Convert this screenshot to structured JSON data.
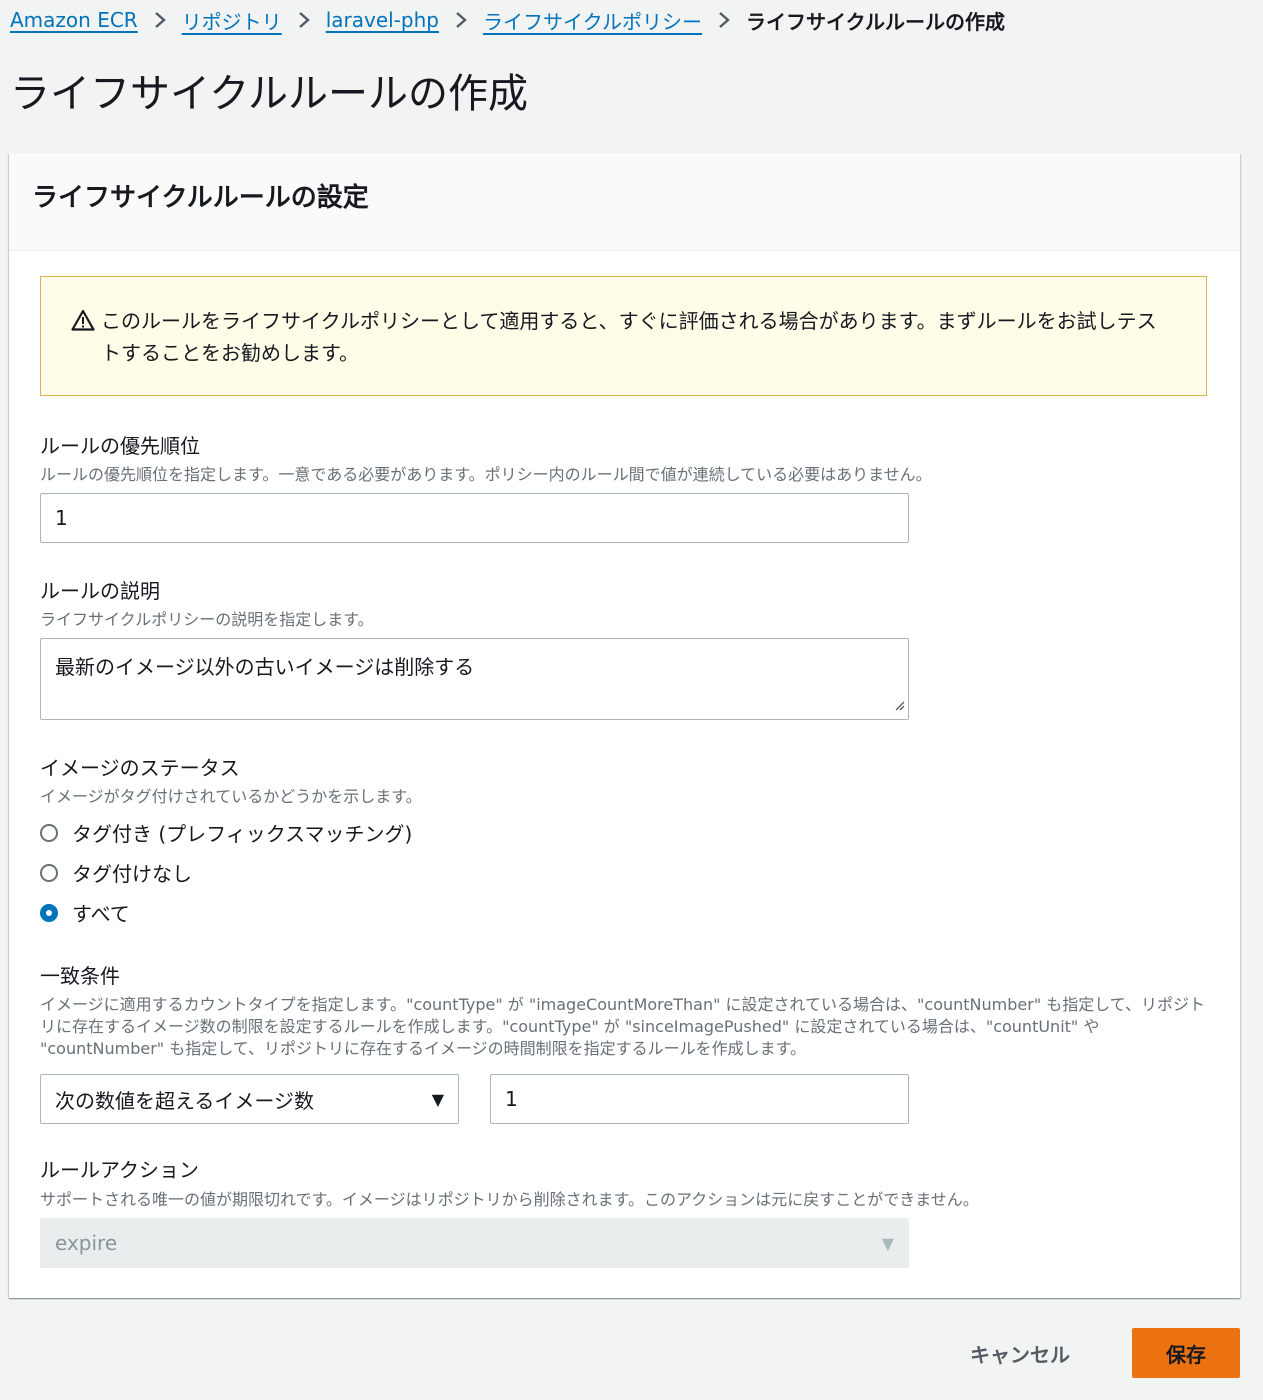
{
  "breadcrumb": {
    "items": [
      "Amazon ECR",
      "リポジトリ",
      "laravel-php",
      "ライフサイクルポリシー"
    ],
    "current": "ライフサイクルルールの作成"
  },
  "page": {
    "title": "ライフサイクルルールの作成"
  },
  "panel": {
    "title": "ライフサイクルルールの設定",
    "alert": "このルールをライフサイクルポリシーとして適用すると、すぐに評価される場合があります。まずルールをお試しテストすることをお勧めします。"
  },
  "priority": {
    "label": "ルールの優先順位",
    "description": "ルールの優先順位を指定します。一意である必要があります。ポリシー内のルール間で値が連続している必要はありません。",
    "value": "1"
  },
  "rule_description": {
    "label": "ルールの説明",
    "description": "ライフサイクルポリシーの説明を指定します。",
    "value": "最新のイメージ以外の古いイメージは削除する"
  },
  "image_status": {
    "label": "イメージのステータス",
    "description": "イメージがタグ付けされているかどうかを示します。",
    "options": [
      "タグ付き (プレフィックスマッチング)",
      "タグ付けなし",
      "すべて"
    ],
    "selected": "すべて"
  },
  "match_criteria": {
    "label": "一致条件",
    "description": "イメージに適用するカウントタイプを指定します。\"countType\" が \"imageCountMoreThan\" に設定されている場合は、\"countNumber\" も指定して、リポジトリに存在するイメージ数の制限を設定するルールを作成します。\"countType\" が \"sinceImagePushed\" に設定されている場合は、\"countUnit\" や \"countNumber\" も指定して、リポジトリに存在するイメージの時間制限を指定するルールを作成します。",
    "count_type": "次の数値を超えるイメージ数",
    "count_number": "1"
  },
  "rule_action": {
    "label": "ルールアクション",
    "description": "サポートされる唯一の値が期限切れです。イメージはリポジトリから削除されます。このアクションは元に戻すことができません。",
    "value": "expire"
  },
  "footer": {
    "cancel": "キャンセル",
    "save": "保存"
  },
  "colors": {
    "link": "#0073bb",
    "primary_button": "#ec7211",
    "alert_bg": "#fffce8",
    "alert_border": "#d8b654"
  }
}
